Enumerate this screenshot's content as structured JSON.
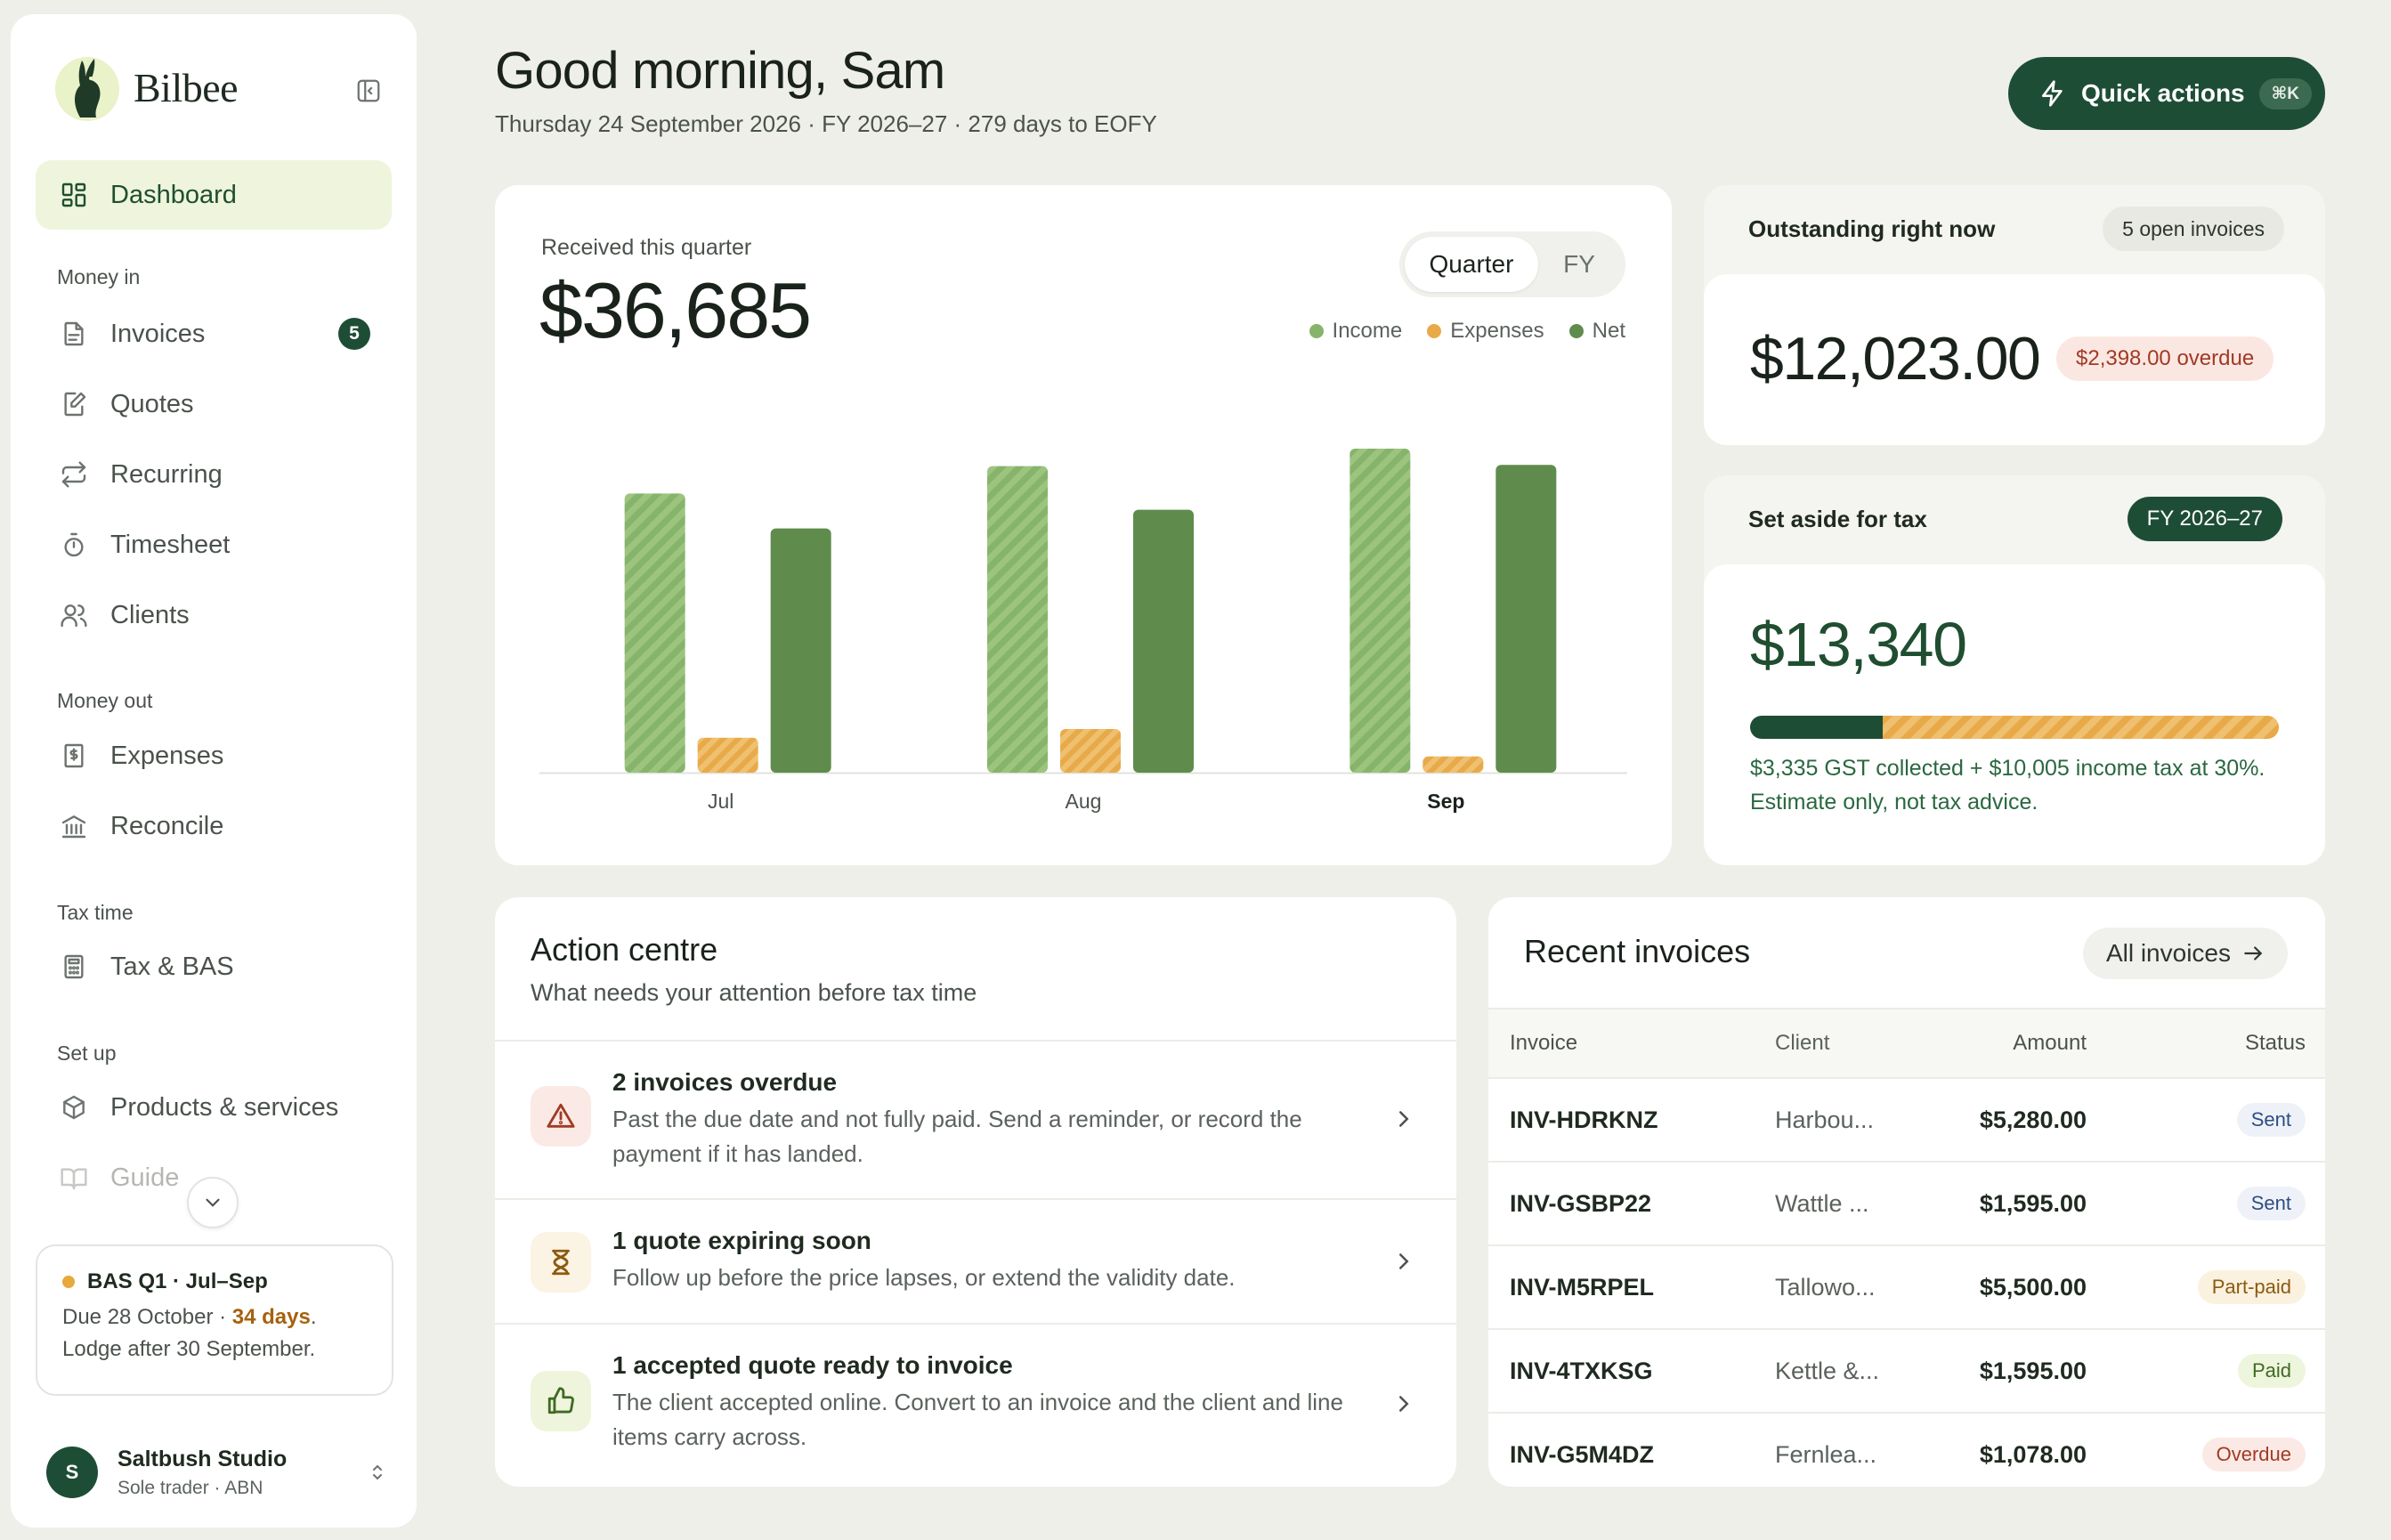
{
  "brand": {
    "name": "Bilbee"
  },
  "sidebar": {
    "dashboard": "Dashboard",
    "sections": {
      "money_in": "Money in",
      "money_out": "Money out",
      "tax_time": "Tax time",
      "set_up": "Set up"
    },
    "items": {
      "invoices": "Invoices",
      "invoices_badge": "5",
      "quotes": "Quotes",
      "recurring": "Recurring",
      "timesheet": "Timesheet",
      "clients": "Clients",
      "expenses": "Expenses",
      "reconcile": "Reconcile",
      "tax_bas": "Tax & BAS",
      "products": "Products & services",
      "guide": "Guide"
    },
    "bas": {
      "title": "BAS Q1 · Jul–Sep",
      "due_prefix": "Due 28 October · ",
      "due_days": "34 days",
      "due_suffix": ".",
      "lodge": "Lodge after 30 September."
    },
    "account": {
      "initial": "S",
      "name": "Saltbush Studio",
      "sub": "Sole trader · ABN"
    }
  },
  "header": {
    "greeting": "Good morning, Sam",
    "subline": "Thursday 24 September 2026 · FY 2026–27 · 279 days to EOFY",
    "quick_actions": "Quick actions",
    "shortcut": "⌘K"
  },
  "overview": {
    "label": "Received this quarter",
    "total": "$36,685",
    "toggle": {
      "active": "Quarter",
      "inactive": "FY"
    }
  },
  "chart_data": {
    "type": "bar",
    "categories": [
      "Jul",
      "Aug",
      "Sep"
    ],
    "series": [
      {
        "name": "Income",
        "values": [
          11200,
          12300,
          13000
        ],
        "color": "#86b46a",
        "pattern": "striped"
      },
      {
        "name": "Expenses",
        "values": [
          1400,
          1750,
          650
        ],
        "color": "#e8aa48",
        "pattern": "striped"
      },
      {
        "name": "Net",
        "values": [
          9800,
          10550,
          12350
        ],
        "color": "#5f8c4d"
      }
    ],
    "ylim": [
      0,
      15000
    ],
    "grid": false,
    "legend": "top-right",
    "selected_category": "Sep"
  },
  "outstanding": {
    "title": "Outstanding right now",
    "pill": "5 open invoices",
    "amount": "$12,023.00",
    "overdue": "$2,398.00 overdue"
  },
  "tax": {
    "title": "Set aside for tax",
    "pill": "FY 2026–27",
    "amount": "$13,340",
    "gst_fraction": 0.25,
    "note": "$3,335 GST collected + $10,005 income tax at 30%. Estimate only, not tax advice."
  },
  "action_centre": {
    "title": "Action centre",
    "subtitle": "What needs your attention before tax time",
    "items": [
      {
        "title": "2 invoices overdue",
        "desc": "Past the due date and not fully paid. Send a reminder, or record the payment if it has landed.",
        "icon": "warning-icon"
      },
      {
        "title": "1 quote expiring soon",
        "desc": "Follow up before the price lapses, or extend the validity date.",
        "icon": "hourglass-icon"
      },
      {
        "title": "1 accepted quote ready to invoice",
        "desc": "The client accepted online. Convert to an invoice and the client and line items carry across.",
        "icon": "thumbs-up-icon"
      }
    ]
  },
  "recent_invoices": {
    "title": "Recent invoices",
    "all_label": "All invoices",
    "headers": {
      "invoice": "Invoice",
      "client": "Client",
      "amount": "Amount",
      "status": "Status"
    },
    "rows": [
      {
        "id": "INV-HDRKNZ",
        "client": "Harbou...",
        "amount": "$5,280.00",
        "status": "Sent"
      },
      {
        "id": "INV-GSBP22",
        "client": "Wattle ...",
        "amount": "$1,595.00",
        "status": "Sent"
      },
      {
        "id": "INV-M5RPEL",
        "client": "Tallowo...",
        "amount": "$5,500.00",
        "status": "Part-paid"
      },
      {
        "id": "INV-4TXKSG",
        "client": "Kettle &...",
        "amount": "$1,595.00",
        "status": "Paid"
      },
      {
        "id": "INV-G5M4DZ",
        "client": "Fernlea...",
        "amount": "$1,078.00",
        "status": "Overdue"
      }
    ]
  }
}
